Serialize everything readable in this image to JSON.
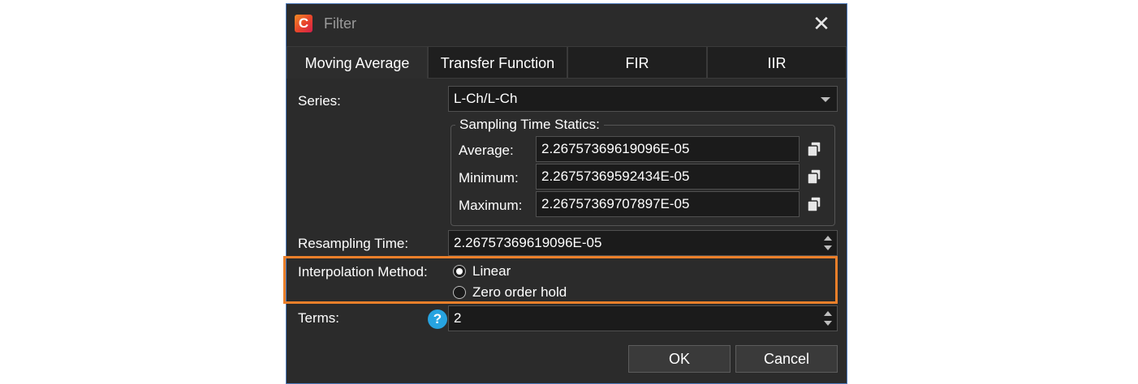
{
  "window": {
    "title": "Filter",
    "app_icon_letter": "C",
    "close_glyph": "✕"
  },
  "tabs": [
    {
      "label": "Moving Average",
      "active": true
    },
    {
      "label": "Transfer Function",
      "active": false
    },
    {
      "label": "FIR",
      "active": false
    },
    {
      "label": "IIR",
      "active": false
    }
  ],
  "form": {
    "series": {
      "label": "Series:",
      "value": "L-Ch/L-Ch"
    },
    "sampling_stats": {
      "legend": "Sampling Time Statics:",
      "rows": [
        {
          "label": "Average:",
          "value": "2.26757369619096E-05"
        },
        {
          "label": "Minimum:",
          "value": "2.26757369592434E-05"
        },
        {
          "label": "Maximum:",
          "value": "2.26757369707897E-05"
        }
      ]
    },
    "resampling_time": {
      "label": "Resampling Time:",
      "value": "2.26757369619096E-05"
    },
    "interpolation": {
      "label": "Interpolation Method:",
      "options": [
        {
          "label": "Linear",
          "selected": true
        },
        {
          "label": "Zero order hold",
          "selected": false
        }
      ]
    },
    "terms": {
      "label": "Terms:",
      "value": "2",
      "help_glyph": "?"
    }
  },
  "buttons": {
    "ok": "OK",
    "cancel": "Cancel"
  },
  "colors": {
    "highlight": "#ea7f2a",
    "help": "#27a3e0",
    "dialog_border": "#4a78b8"
  }
}
